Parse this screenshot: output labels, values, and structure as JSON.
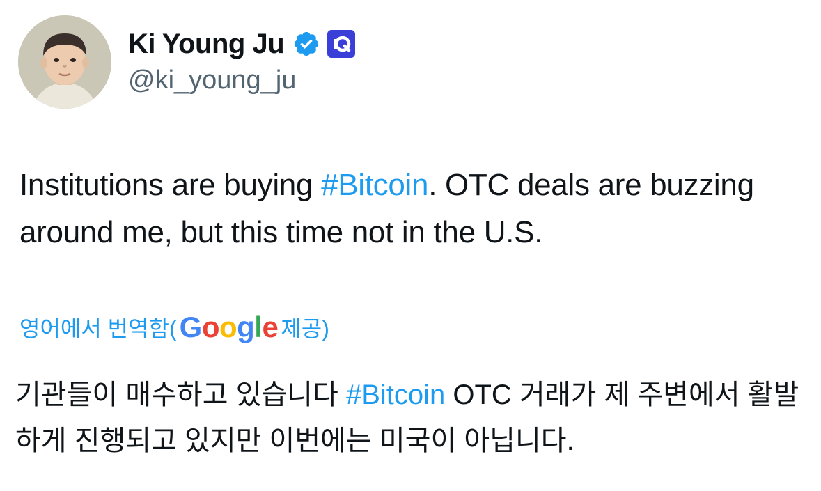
{
  "author": {
    "display_name": "Ki Young Ju",
    "handle": "@ki_young_ju",
    "verified": true,
    "affiliate_badge": "cryptoquant-logo-icon"
  },
  "tweet": {
    "text_part1": "Institutions are buying ",
    "hashtag": "#Bitcoin",
    "text_part2": ". OTC deals are buzzing around me, but this time not in the U.S."
  },
  "translation": {
    "label": "영어에서 번역함(",
    "google_letters": [
      "G",
      "o",
      "o",
      "g",
      "l",
      "e"
    ],
    "provided": " 제공)",
    "text_part1": "기관들이 매수하고 있습니다 ",
    "hashtag": "#Bitcoin",
    "text_part2": " OTC 거래가 제 주변에서 활발하게 진행되고 있지만 이번에는 미국이 아닙니다."
  },
  "colors": {
    "link": "#1d9bf0",
    "text": "#0f1419",
    "secondary": "#536471",
    "affiliate_bg": "#3a3fd8"
  }
}
